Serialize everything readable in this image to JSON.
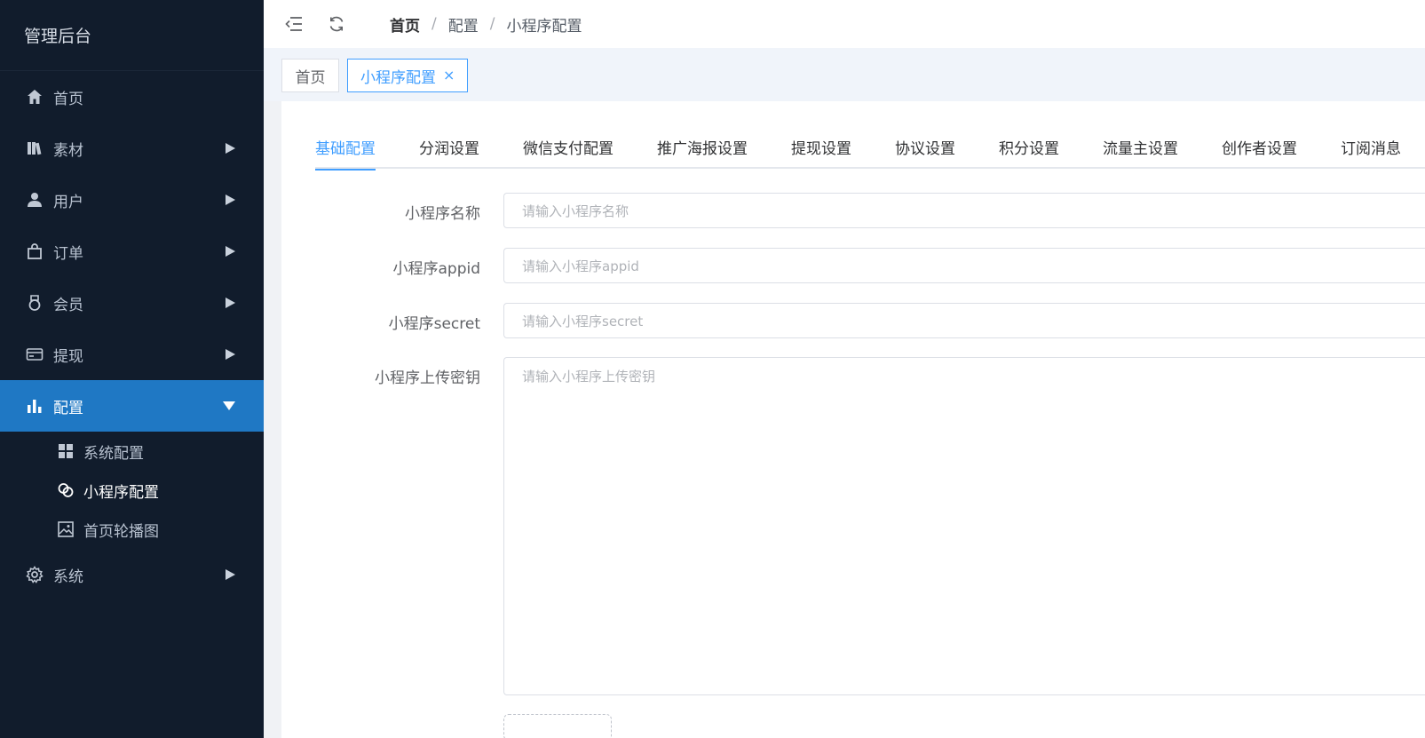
{
  "sidebar": {
    "brand": "管理后台",
    "items": [
      {
        "label": "首页",
        "icon": "home-icon"
      },
      {
        "label": "素材",
        "icon": "library-icon"
      },
      {
        "label": "用户",
        "icon": "user-icon"
      },
      {
        "label": "订单",
        "icon": "bag-icon"
      },
      {
        "label": "会员",
        "icon": "medal-icon"
      },
      {
        "label": "提现",
        "icon": "card-icon"
      },
      {
        "label": "配置",
        "icon": "bar-chart-icon"
      },
      {
        "label": "系统",
        "icon": "gear-icon"
      }
    ],
    "subitems": [
      {
        "label": "系统配置",
        "icon": "grid-icon"
      },
      {
        "label": "小程序配置",
        "icon": "mini-program-icon"
      },
      {
        "label": "首页轮播图",
        "icon": "image-icon"
      }
    ]
  },
  "header": {
    "breadcrumb": [
      "首页",
      "配置",
      "小程序配置"
    ],
    "separator": "/"
  },
  "tagsbar": {
    "tags": [
      "首页",
      "小程序配置"
    ],
    "close": "×"
  },
  "tabs": [
    "基础配置",
    "分润设置",
    "微信支付配置",
    "推广海报设置",
    "提现设置",
    "协议设置",
    "积分设置",
    "流量主设置",
    "创作者设置",
    "订阅消息"
  ],
  "form": {
    "fields": [
      {
        "label": "小程序名称",
        "placeholder": "请输入小程序名称"
      },
      {
        "label": "小程序appid",
        "placeholder": "请输入小程序appid"
      },
      {
        "label": "小程序secret",
        "placeholder": "请输入小程序secret"
      },
      {
        "label": "小程序上传密钥",
        "placeholder": "请输入小程序上传密钥"
      }
    ]
  },
  "colors": {
    "sidebar_bg": "#111c2c",
    "active_menu": "#1f78c4",
    "accent": "#409eff"
  }
}
